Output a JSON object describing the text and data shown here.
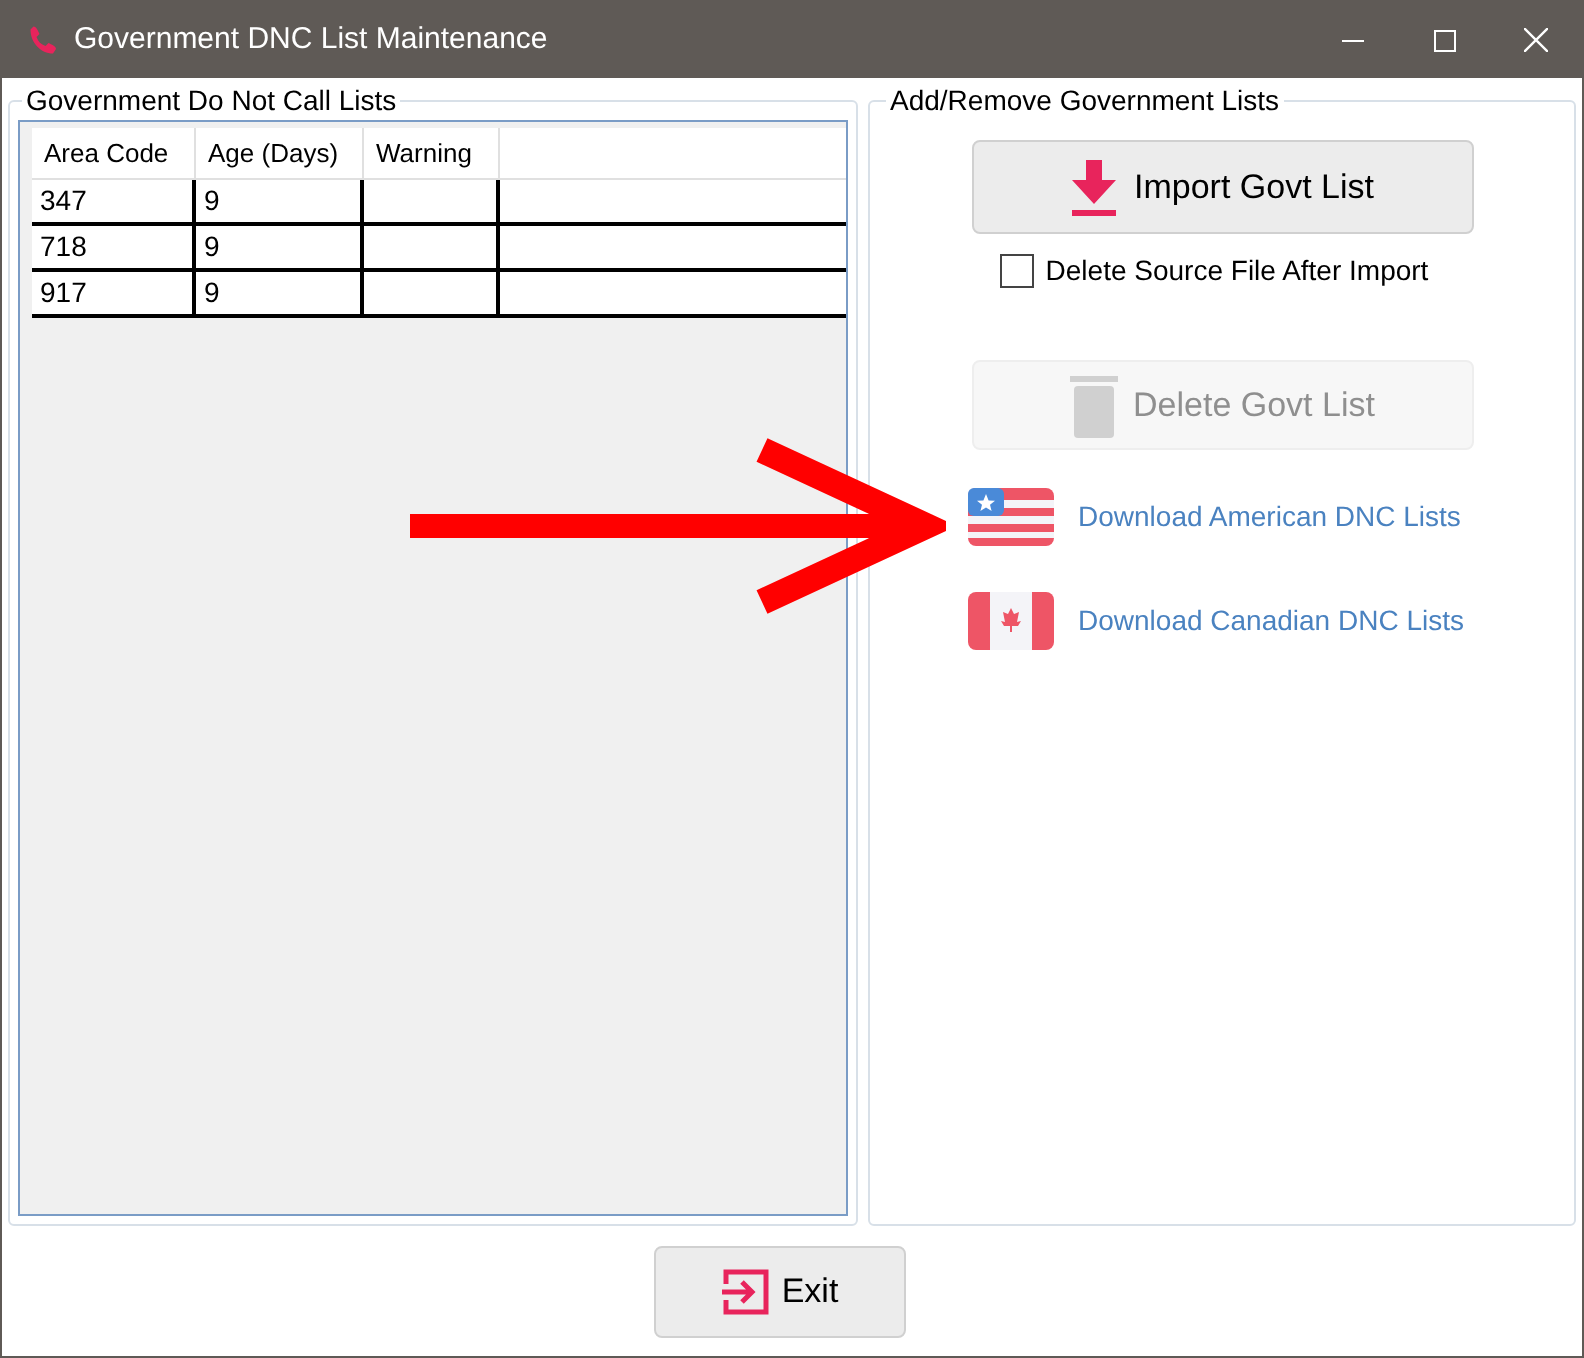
{
  "window": {
    "title": "Government DNC List Maintenance"
  },
  "lists_group": {
    "title": "Government Do Not Call Lists",
    "columns": [
      "Area Code",
      "Age (Days)",
      "Warning"
    ],
    "rows": [
      [
        "347",
        "9",
        ""
      ],
      [
        "718",
        "9",
        ""
      ],
      [
        "917",
        "9",
        ""
      ]
    ]
  },
  "actions_group": {
    "title": "Add/Remove Government Lists",
    "import_button": {
      "label": "Import Govt List",
      "disabled": false
    },
    "delete_source_checkbox": {
      "label": "Delete Source File After Import",
      "checked": false
    },
    "delete_button": {
      "label": "Delete Govt List",
      "disabled": true
    },
    "links": [
      {
        "kind": "us",
        "label": "Download American DNC Lists"
      },
      {
        "kind": "ca",
        "label": "Download Canadian DNC Lists"
      }
    ]
  },
  "exit_button": {
    "label": "Exit"
  }
}
